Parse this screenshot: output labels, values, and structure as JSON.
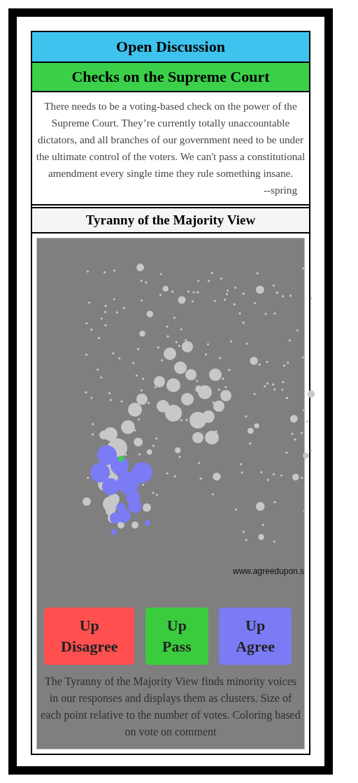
{
  "header": {
    "title": "Open Discussion"
  },
  "topic": {
    "title": "Checks on the Supreme Court"
  },
  "comment": {
    "text": "There needs to be a voting-based check on the power of the Supreme Court. They’re currently totally unaccountable dictators, and all branches of our government need to be under the ultimate control of the voters. We can't pass a constitutional amendment every single time they rule something insane.",
    "author": "--spring"
  },
  "view": {
    "title": "Tyranny of the Majority View",
    "credit": "www.agreedupon.s",
    "buttons": [
      {
        "label": "Up Disagree",
        "color": "#ff4f4f"
      },
      {
        "label": "Up Pass",
        "color": "#3bcc3e"
      },
      {
        "label": "Up Agree",
        "color": "#7b7bf5"
      }
    ],
    "description": "The Tyranny of the Majority View finds minority voices in our responses and displays them as clusters. Size of each point relative to the number of votes. Coloring based on vote on comment"
  }
}
